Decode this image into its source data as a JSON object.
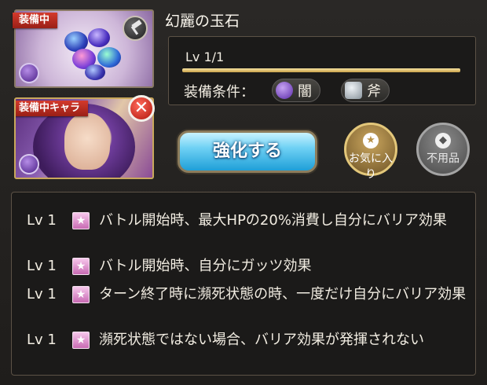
{
  "equipped_item": {
    "ribbon": "装備中",
    "icons": [
      "gem-cluster-icon",
      "hammer-icon",
      "dark-element-icon"
    ]
  },
  "equipped_character": {
    "ribbon": "装備中キャラ",
    "close_symbol": "✕",
    "icons": [
      "dark-element-icon",
      "close-icon"
    ]
  },
  "item": {
    "name": "幻麗の玉石",
    "level_text": "Lv 1/1",
    "level_progress": 1.0,
    "condition_label": "装備条件：",
    "conditions": [
      {
        "label": "闇",
        "icon": "dark-element-icon",
        "color": "#7b46c8"
      },
      {
        "label": "斧",
        "icon": "axe-icon",
        "color": "#9aa3aa"
      }
    ]
  },
  "buttons": {
    "enhance": "強化する",
    "favorite": "お気に入り",
    "unused": "不用品"
  },
  "skills": [
    {
      "level": "Lv 1",
      "text": "バトル開始時、最大HPの20%消費し自分にバリア効果"
    },
    {
      "level": "Lv 1",
      "text": "バトル開始時、自分にガッツ効果"
    },
    {
      "level": "Lv 1",
      "text": "ターン終了時に瀕死状態の時、一度だけ自分にバリア効果"
    },
    {
      "level": "Lv 1",
      "text": "瀕死状態ではない場合、バリア効果が発揮されない"
    }
  ],
  "colors": {
    "ribbon": "#c2302a",
    "enhance_button": "#3bb7e6",
    "favorite_button": "#b89248",
    "level_bar": "#e6c46a"
  }
}
